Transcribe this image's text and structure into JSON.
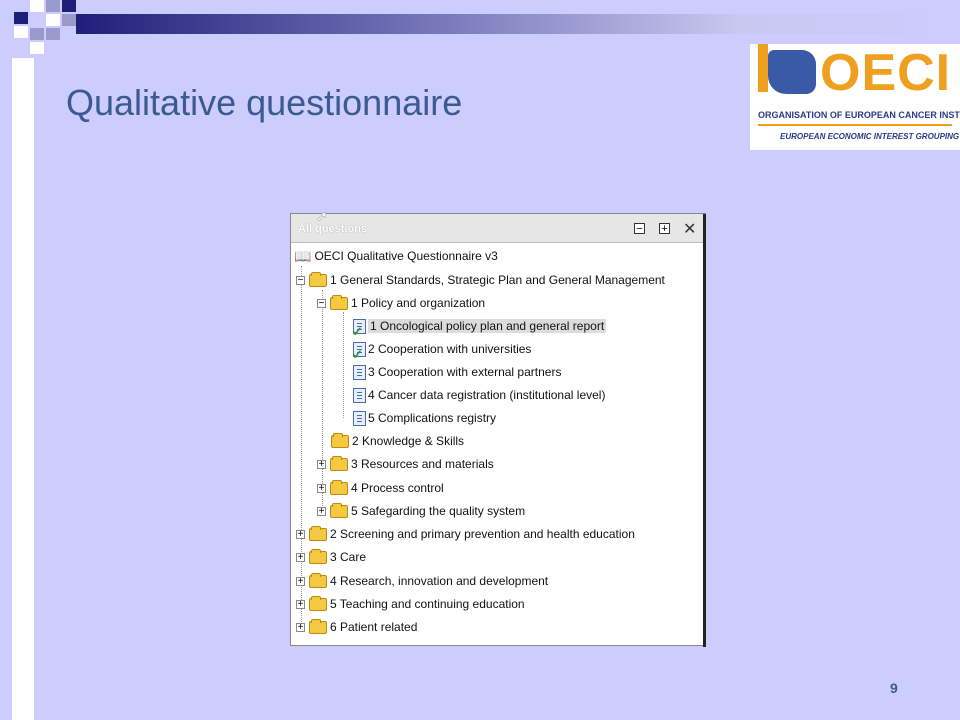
{
  "slide": {
    "title": "Qualitative questionnaire",
    "page_number": "9"
  },
  "logo": {
    "name": "OECI",
    "line1": "Organisation of European Cancer Institutes",
    "line2": "European Economic Interest Grouping",
    "colors": {
      "orange": "#f0a020",
      "navy": "#2a3a8a"
    }
  },
  "panel": {
    "title": "All questions",
    "root": "OECI Qualitative Questionnaire v3",
    "items": [
      {
        "label": "1 General Standards, Strategic Plan and General Management",
        "type": "folder",
        "expander": "−"
      },
      {
        "label": "1 Policy and organization",
        "type": "folder",
        "expander": "−"
      },
      {
        "label": "1 Oncological policy plan and general report",
        "type": "doc",
        "checked": true,
        "selected": true
      },
      {
        "label": "2 Cooperation with universities",
        "type": "doc",
        "checked": true
      },
      {
        "label": "3 Cooperation with external partners",
        "type": "doc"
      },
      {
        "label": "4 Cancer data registration (institutional level)",
        "type": "doc"
      },
      {
        "label": "5 Complications registry",
        "type": "doc"
      },
      {
        "label": "2 Knowledge & Skills",
        "type": "folder"
      },
      {
        "label": "3 Resources and materials",
        "type": "folder",
        "expander": "+"
      },
      {
        "label": "4 Process control",
        "type": "folder",
        "expander": "+"
      },
      {
        "label": "5 Safegarding the quality system",
        "type": "folder",
        "expander": "+"
      },
      {
        "label": "2 Screening and primary prevention and health education",
        "type": "folder",
        "expander": "+"
      },
      {
        "label": "3 Care",
        "type": "folder",
        "expander": "+"
      },
      {
        "label": "4 Research, innovation and development",
        "type": "folder",
        "expander": "+"
      },
      {
        "label": "5 Teaching and continuing education",
        "type": "folder",
        "expander": "+"
      },
      {
        "label": "6 Patient related",
        "type": "folder",
        "expander": "+"
      }
    ]
  }
}
